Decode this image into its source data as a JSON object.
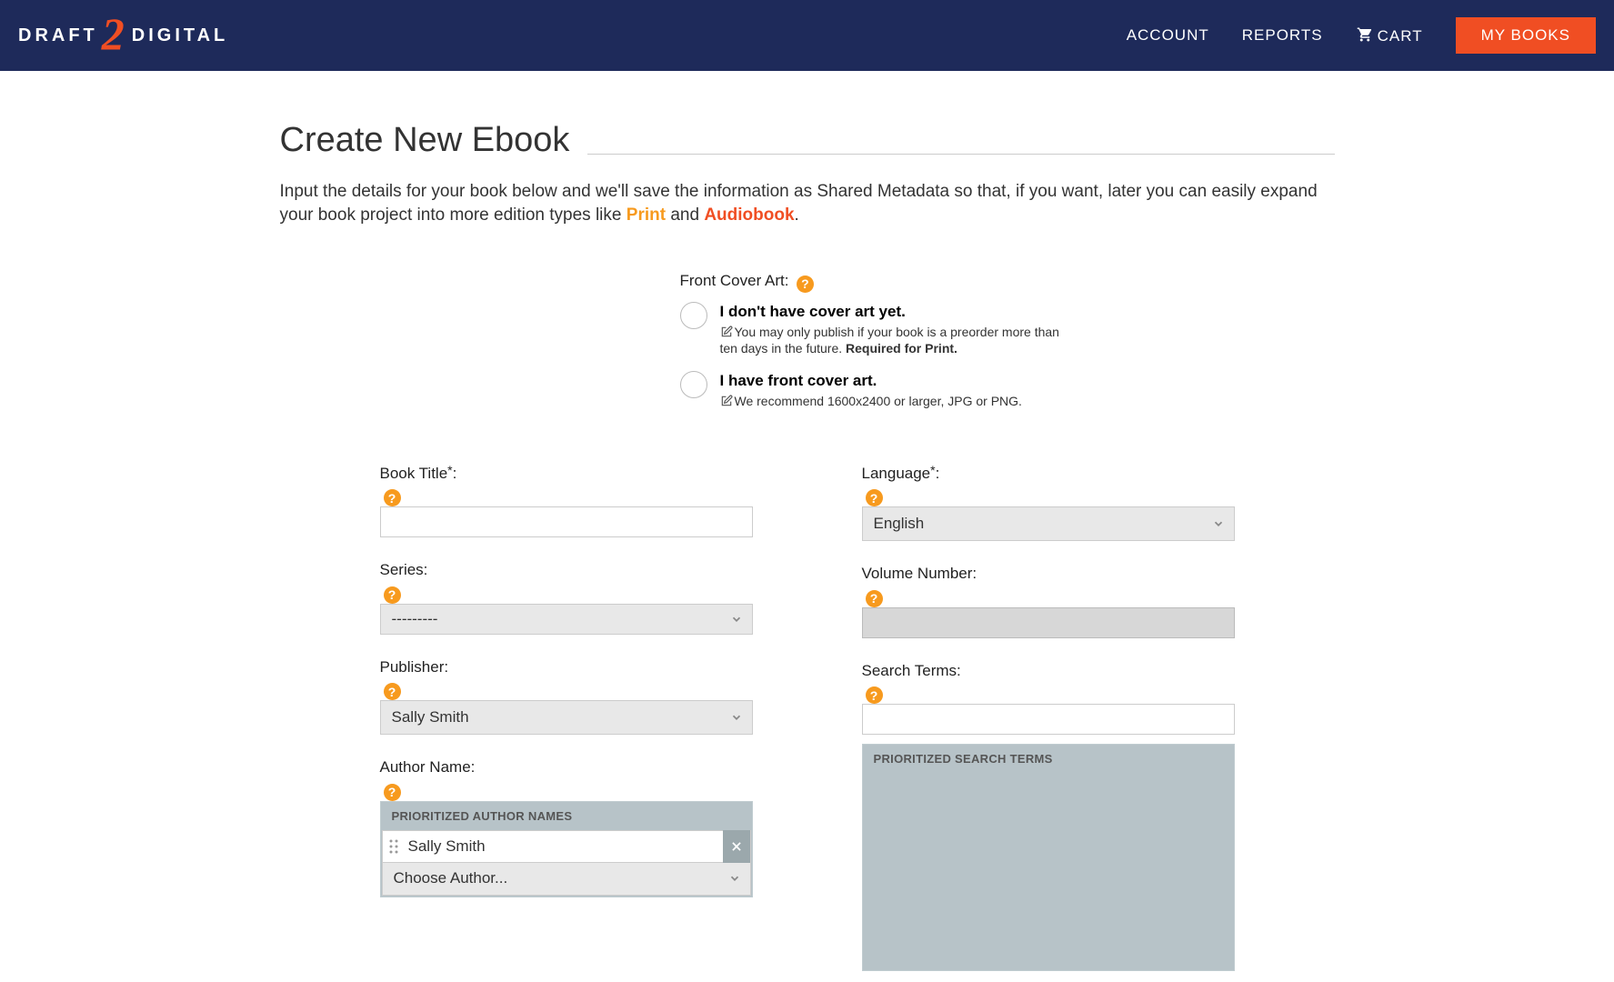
{
  "nav": {
    "logo_left": "DRAFT",
    "logo_right": "DIGITAL",
    "account": "ACCOUNT",
    "reports": "REPORTS",
    "cart": "CART",
    "mybooks": "MY BOOKS"
  },
  "page": {
    "title": "Create New Ebook",
    "intro_a": "Input the details for your book below and we'll save the information as Shared Metadata so that, if you want, later you can easily expand your book project into more edition types like ",
    "intro_print": "Print",
    "intro_and": " and ",
    "intro_audio": "Audiobook",
    "intro_end": "."
  },
  "cover": {
    "label": "Front Cover Art:",
    "opt1_title": "I don't have cover art yet.",
    "opt1_note_a": "You may only publish if your book is a preorder more than ten days in the future. ",
    "opt1_note_b": "Required for Print.",
    "opt2_title": "I have front cover art.",
    "opt2_note": "We recommend 1600x2400 or larger, JPG or PNG."
  },
  "left": {
    "book_title_label": "Book Title",
    "series_label": "Series:",
    "series_value": "---------",
    "publisher_label": "Publisher:",
    "publisher_value": "Sally Smith",
    "author_label": "Author Name:",
    "author_hdr": "PRIORITIZED AUTHOR NAMES",
    "author_chip": "Sally Smith",
    "author_choose": "Choose Author..."
  },
  "right": {
    "language_label": "Language",
    "language_value": "English",
    "volume_label": "Volume Number:",
    "search_label": "Search Terms:",
    "search_hdr": "PRIORITIZED SEARCH TERMS"
  }
}
